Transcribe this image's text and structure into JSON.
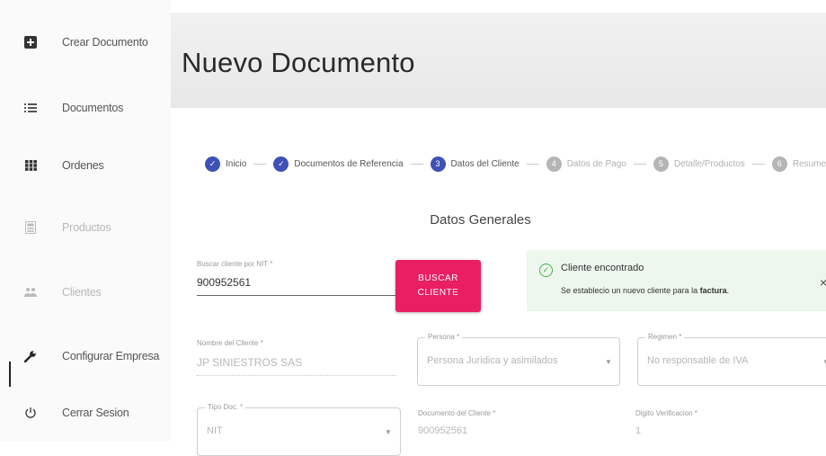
{
  "sidebar": {
    "items": [
      {
        "label": "Crear Documento",
        "icon": "add-box-icon"
      },
      {
        "label": "Documentos",
        "icon": "list-icon"
      },
      {
        "label": "Ordenes",
        "icon": "grid-icon"
      },
      {
        "label": "Productos",
        "icon": "calculator-icon"
      },
      {
        "label": "Clientes",
        "icon": "people-icon"
      },
      {
        "label": "Configurar Empresa",
        "icon": "wrench-icon"
      },
      {
        "label": "Cerrar Sesion",
        "icon": "power-icon"
      }
    ]
  },
  "header": {
    "title": "Nuevo Documento"
  },
  "stepper": {
    "steps": [
      {
        "label": "Inicio",
        "marker": "✓",
        "state": "done"
      },
      {
        "label": "Documentos de Referencia",
        "marker": "✓",
        "state": "done"
      },
      {
        "label": "Datos del Cliente",
        "marker": "3",
        "state": "active"
      },
      {
        "label": "Datos de Pago",
        "marker": "4",
        "state": "pending"
      },
      {
        "label": "Detalle/Productos",
        "marker": "5",
        "state": "pending"
      },
      {
        "label": "Resumen",
        "marker": "6",
        "state": "pending"
      }
    ]
  },
  "form": {
    "section_title": "Datos Generales",
    "search": {
      "label": "Buscar cliente por NIT *",
      "value": "900952561"
    },
    "search_button": {
      "line1": "BUSCAR",
      "line2": "CLIENTE"
    },
    "alert": {
      "title": "Cliente encontrado",
      "message_prefix": "Se establecio un nuevo cliente para la ",
      "message_bold": "factura",
      "message_suffix": ".",
      "close": "×"
    },
    "nombre_cliente": {
      "label": "Nombre del Cliente *",
      "value": "JP SINIESTROS SAS"
    },
    "persona": {
      "label": "Persona *",
      "value": "Persona Juridica y asimilados"
    },
    "regimen": {
      "label": "Regimen *",
      "value": "No responsable de IVA"
    },
    "tipo_doc": {
      "label": "Tipo Doc. *",
      "value": "NIT"
    },
    "documento_cliente": {
      "label": "Documento del Cliente *",
      "value": "900952561"
    },
    "digito_verificacion": {
      "label": "Digito Verificacion *",
      "value": "1"
    }
  },
  "colors": {
    "accent": "#3f51b5",
    "button": "#e91e63",
    "alert_bg": "#edf7ed",
    "alert_icon": "#4caf50"
  }
}
